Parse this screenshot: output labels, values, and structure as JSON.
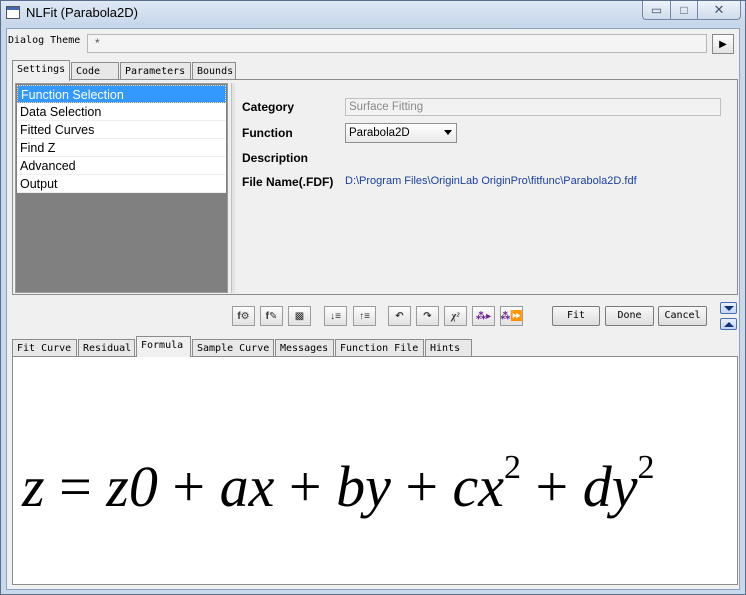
{
  "window": {
    "title": "NLFit (Parabola2D)"
  },
  "caption_buttons": {
    "minimize": "▭",
    "maximize": "□",
    "close": "✕"
  },
  "dialog_theme": {
    "label": "Dialog Theme",
    "value": "*"
  },
  "top_tabs": [
    "Settings",
    "Code",
    "Parameters",
    "Bounds"
  ],
  "nav_items": [
    "Function Selection",
    "Data Selection",
    "Fitted Curves",
    "Find Z",
    "Advanced",
    "Output"
  ],
  "properties": {
    "category_label": "Category",
    "category_value": "Surface Fitting",
    "function_label": "Function",
    "function_value": "Parabola2D",
    "description_label": "Description",
    "file_name_label": "File Name(.FDF)",
    "file_name_value": "D:\\Program Files\\OriginLab OriginPro\\fitfunc\\Parabola2D.fdf"
  },
  "buttons": {
    "fit": "Fit",
    "done": "Done",
    "cancel": "Cancel"
  },
  "bottom_tabs": [
    "Fit Curve",
    "Residual",
    "Formula",
    "Sample Curve",
    "Messages",
    "Function File",
    "Hints"
  ],
  "formula": {
    "lhs": "z",
    "eq": "=",
    "t1": "z0",
    "t2": "ax",
    "t3": "by",
    "t4": "cx",
    "t5": "dy",
    "exp": "2",
    "plus": "+"
  }
}
